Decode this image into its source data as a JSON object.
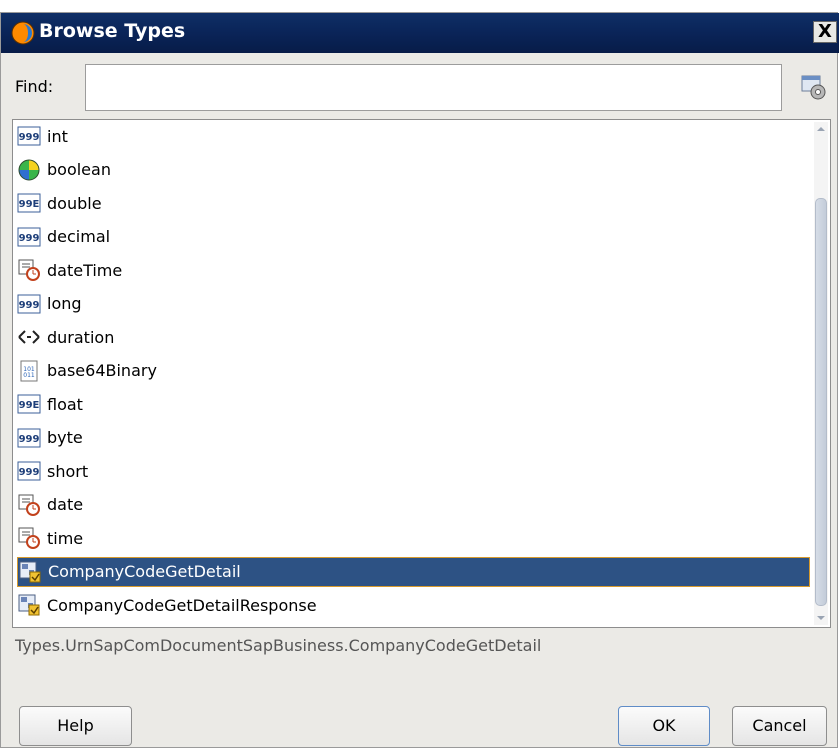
{
  "window": {
    "title": "Browse Types",
    "close_label": "X"
  },
  "find": {
    "label": "Find:",
    "value": "",
    "placeholder": ""
  },
  "list": {
    "items": [
      {
        "label": "int",
        "icon": "numeric-999-icon"
      },
      {
        "label": "boolean",
        "icon": "boolean-ball-icon"
      },
      {
        "label": "double",
        "icon": "numeric-99e-icon"
      },
      {
        "label": "decimal",
        "icon": "numeric-999-icon"
      },
      {
        "label": "dateTime",
        "icon": "date-clock-icon"
      },
      {
        "label": "long",
        "icon": "numeric-999-icon"
      },
      {
        "label": "duration",
        "icon": "duration-arrows-icon"
      },
      {
        "label": "base64Binary",
        "icon": "binary-file-icon"
      },
      {
        "label": "float",
        "icon": "numeric-99e-icon"
      },
      {
        "label": "byte",
        "icon": "numeric-999-icon"
      },
      {
        "label": "short",
        "icon": "numeric-999-icon"
      },
      {
        "label": "date",
        "icon": "date-clock-icon"
      },
      {
        "label": "time",
        "icon": "date-clock-icon"
      },
      {
        "label": "CompanyCodeGetDetail",
        "icon": "complex-type-icon",
        "selected": true
      },
      {
        "label": "CompanyCodeGetDetailResponse",
        "icon": "complex-type-icon"
      }
    ]
  },
  "path_text": "Types.UrnSapComDocumentSapBusiness.CompanyCodeGetDetail",
  "buttons": {
    "help": "Help",
    "ok": "OK",
    "cancel": "Cancel"
  },
  "colors": {
    "titlebar": "#0a2458",
    "selection": "#2d5284",
    "selection_border": "#d69a2d"
  }
}
